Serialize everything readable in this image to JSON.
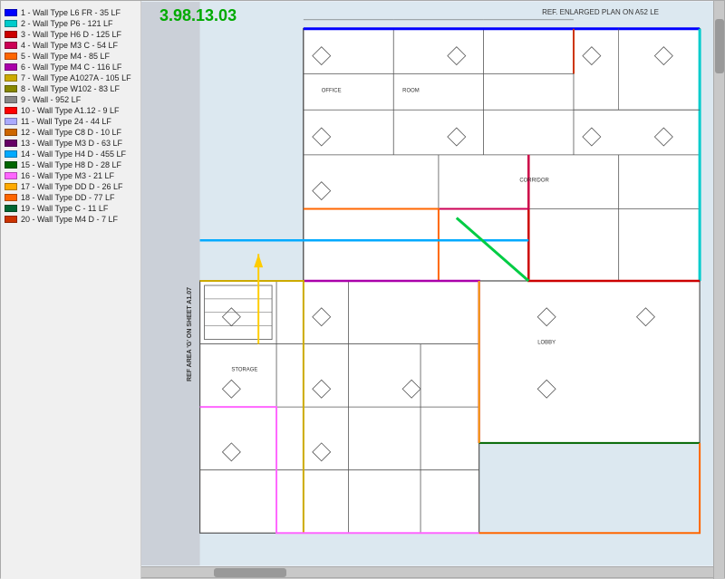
{
  "app": {
    "title": "3.98.13.03",
    "ref_label": "REF. ENLARGED PLAN ON A52 LE"
  },
  "legend": {
    "items": [
      {
        "id": 1,
        "label": "1 - Wall Type L6 FR - 35 LF",
        "color": "#0000ff"
      },
      {
        "id": 2,
        "label": "2 - Wall Type P6 - 121 LF",
        "color": "#00cccc"
      },
      {
        "id": 3,
        "label": "3 - Wall Type H6 D - 125 LF",
        "color": "#cc0000"
      },
      {
        "id": 4,
        "label": "4 - Wall Type M3 C - 54 LF",
        "color": "#cc0055"
      },
      {
        "id": 5,
        "label": "5 - Wall Type M4 - 85 LF",
        "color": "#ff6600"
      },
      {
        "id": 6,
        "label": "6 - Wall Type M4 C - 116 LF",
        "color": "#aa00aa"
      },
      {
        "id": 7,
        "label": "7 - Wall Type A1027A - 105 LF",
        "color": "#ccaa00"
      },
      {
        "id": 8,
        "label": "8 - Wall Type W102 - 83 LF",
        "color": "#888800"
      },
      {
        "id": 9,
        "label": "9 - Wall - 952 LF",
        "color": "#888888"
      },
      {
        "id": 10,
        "label": "10 - Wall Type A1.12 - 9 LF",
        "color": "#ff0000"
      },
      {
        "id": 11,
        "label": "11 - Wall Type 24 - 44 LF",
        "color": "#aaaaff"
      },
      {
        "id": 12,
        "label": "12 - Wall Type C8 D - 10 LF",
        "color": "#cc6600"
      },
      {
        "id": 13,
        "label": "13 - Wall Type M3 D - 63 LF",
        "color": "#660066"
      },
      {
        "id": 14,
        "label": "14 - Wall Type H4 D - 455 LF",
        "color": "#00aaff"
      },
      {
        "id": 15,
        "label": "15 - Wall Type H8 D - 28 LF",
        "color": "#006600"
      },
      {
        "id": 16,
        "label": "16 - Wall Type M3 - 21 LF",
        "color": "#ff66ff"
      },
      {
        "id": 17,
        "label": "17 - Wall Type DD D - 26 LF",
        "color": "#ffaa00"
      },
      {
        "id": 18,
        "label": "18 - Wall Type DD - 77 LF",
        "color": "#ff6600"
      },
      {
        "id": 19,
        "label": "19 - Wall Type C - 11 LF",
        "color": "#006633"
      },
      {
        "id": 20,
        "label": "20 - Wall Type M4 D - 7 LF",
        "color": "#cc3300"
      }
    ]
  },
  "ref_area_text": "REF AREA 'G' ON SHEET A1.07",
  "scrollbar": {
    "right_visible": true,
    "bottom_visible": true
  }
}
